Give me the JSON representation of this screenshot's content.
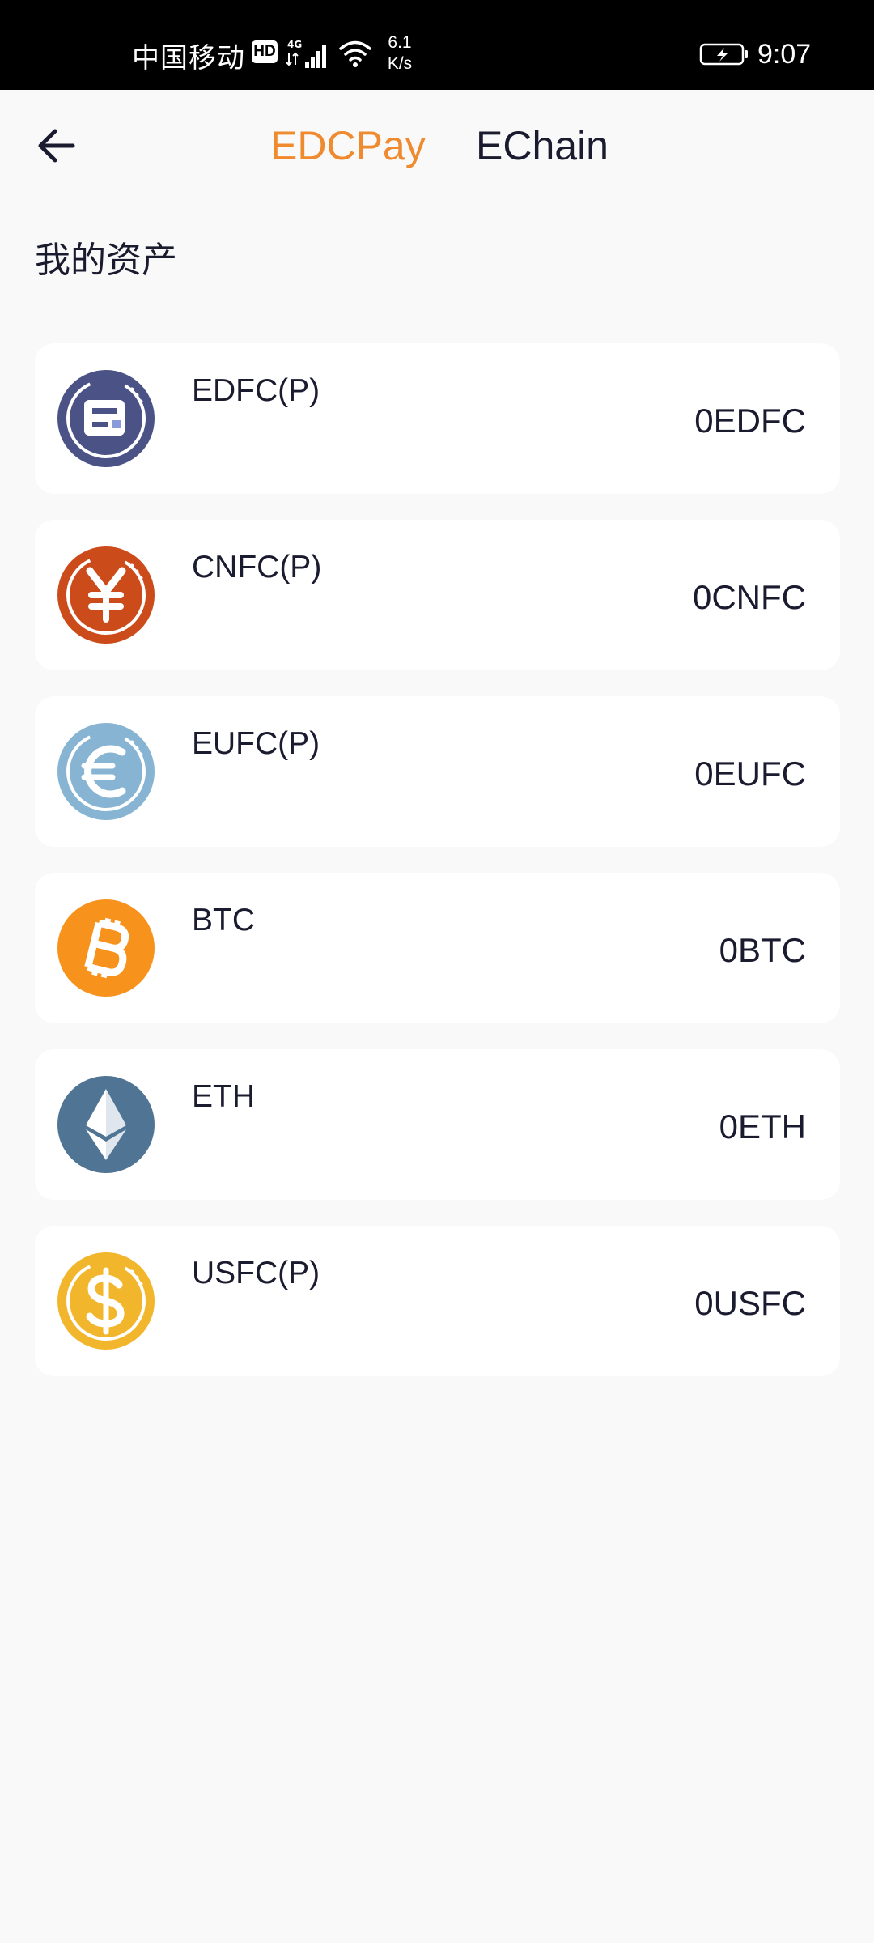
{
  "status_bar": {
    "carrier": "中国移动",
    "hd": "HD",
    "network": "4G",
    "speed_value": "6.1",
    "speed_unit": "K/s",
    "time": "9:07"
  },
  "header": {
    "tabs": [
      {
        "label": "EDCPay",
        "active": true
      },
      {
        "label": "EChain",
        "active": false
      }
    ]
  },
  "section_title": "我的资产",
  "colors": {
    "accent": "#ef8a2f",
    "text": "#1b1b30",
    "background": "#f9f9f9",
    "card": "#ffffff"
  },
  "assets": [
    {
      "name": "EDFC(P)",
      "balance": "0EDFC",
      "icon": "edfc-token-icon",
      "color": "#4a5286"
    },
    {
      "name": "CNFC(P)",
      "balance": "0CNFC",
      "icon": "yuan-token-icon",
      "color": "#cc4b1b"
    },
    {
      "name": "EUFC(P)",
      "balance": "0EUFC",
      "icon": "euro-token-icon",
      "color": "#86b4d2"
    },
    {
      "name": "BTC",
      "balance": "0BTC",
      "icon": "bitcoin-icon",
      "color": "#f7931d"
    },
    {
      "name": "ETH",
      "balance": "0ETH",
      "icon": "ethereum-icon",
      "color": "#4f7494"
    },
    {
      "name": "USFC(P)",
      "balance": "0USFC",
      "icon": "dollar-token-icon",
      "color": "#f2b62c"
    }
  ]
}
